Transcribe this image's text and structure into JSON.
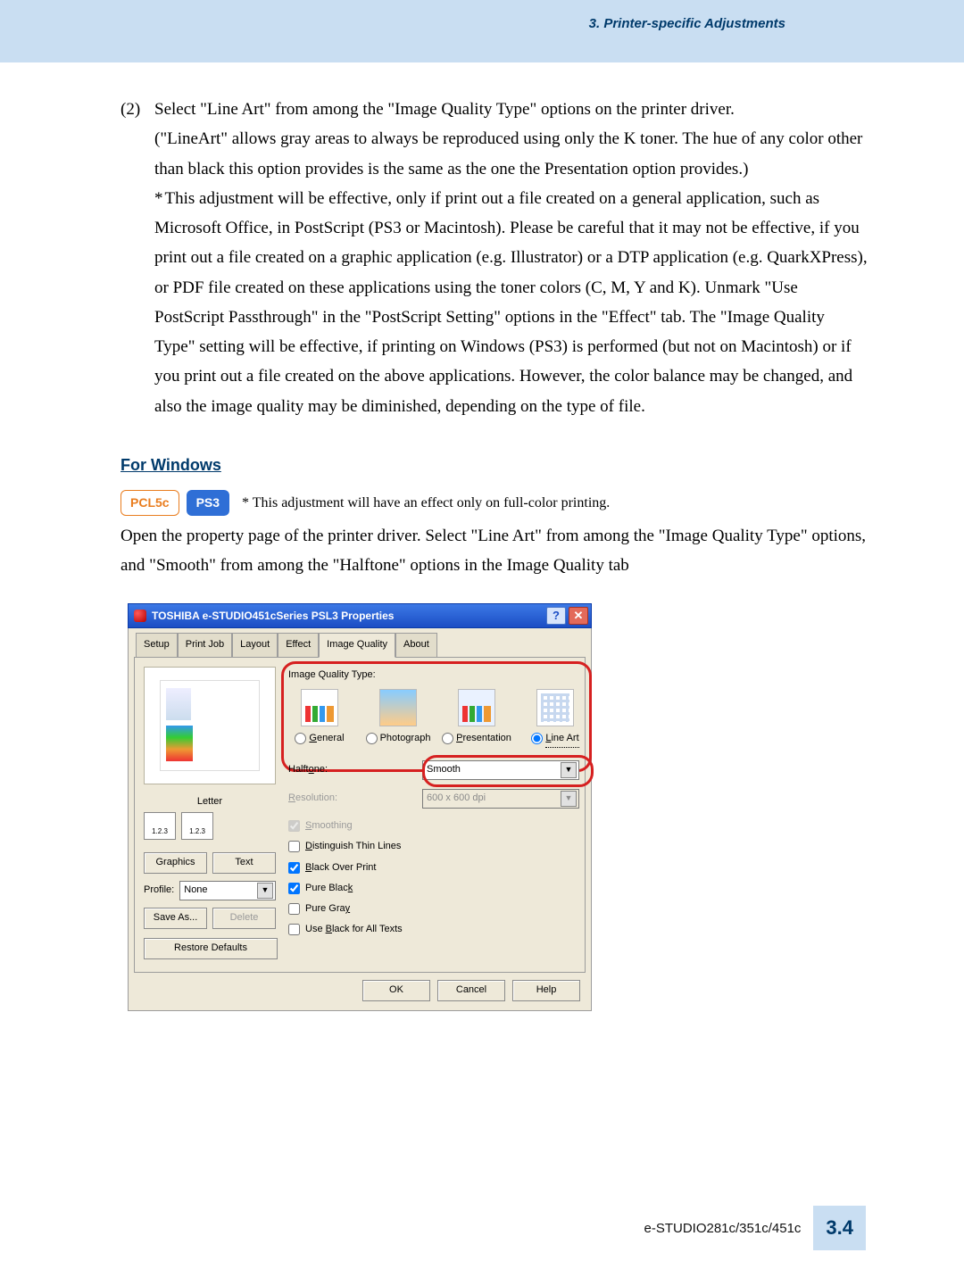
{
  "header": {
    "section": "3. Printer-specific Adjustments"
  },
  "body": {
    "step_num": "(2)",
    "step_line1": "Select \"Line Art\" from among the \"Image Quality Type\" options on the printer driver.",
    "step_line2": "(\"LineArt\" allows gray areas to always be reproduced using only the K toner.  The hue of any color other than black this option provides is the same as the one the Presentation option provides.)",
    "note_star": "*",
    "note_body": "This adjustment will be effective, only if print out a file created on a general application, such as Microsoft Office, in PostScript (PS3 or Macintosh).  Please be careful that it may not be effective, if you print out a file created on a graphic application (e.g. Illustrator) or a DTP application (e.g. QuarkXPress), or PDF file created on these applications using the toner colors (C, M, Y and K).  Unmark \"Use PostScript Passthrough\" in the \"PostScript Setting\" options in the \"Effect\" tab.  The \"Image Quality Type\" setting will be effective, if printing on Windows (PS3) is performed (but not on Macintosh) or if you print out a file created on the above applications.  However, the color balance may be changed, and also the image quality may be diminished, depending on the type of file.",
    "for_windows": "For Windows",
    "chip_pcl": "PCL5c",
    "chip_ps": "PS3",
    "chip_note": "* This adjustment will have an effect only on full-color printing.",
    "para2": "Open the property page of the printer driver.  Select \"Line Art\" from among the \"Image Quality Type\" options, and \"Smooth\" from among the \"Halftone\" options in the Image Quality tab"
  },
  "dialog": {
    "title": "TOSHIBA e-STUDIO451cSeries PSL3 Properties",
    "help_btn": "?",
    "close_btn": "✕",
    "tabs": [
      "Setup",
      "Print Job",
      "Layout",
      "Effect",
      "Image Quality",
      "About"
    ],
    "active_tab": 4,
    "left": {
      "paper": "Letter",
      "icon_cap": "1.2.3",
      "btn_graphics": "Graphics",
      "btn_text": "Text",
      "profile_label": "Profile:",
      "profile_value": "None",
      "btn_save": "Save As...",
      "btn_delete": "Delete",
      "btn_restore": "Restore Defaults"
    },
    "right": {
      "iq_label": "Image Quality Type:",
      "opts": {
        "general": "General",
        "photo": "Photograph",
        "presentation": "Presentation",
        "lineart": "Line Art"
      },
      "halftone_label": "Halftone:",
      "halftone_value": "Smooth",
      "resolution_label": "Resolution:",
      "resolution_value": "600 x 600 dpi",
      "cb_smoothing": "Smoothing",
      "cb_thin": "Distinguish Thin Lines",
      "cb_bop": "Black Over Print",
      "cb_pblack": "Pure Black",
      "cb_pgray": "Pure Gray",
      "cb_useblack": "Use Black for All Texts"
    },
    "footer": {
      "ok": "OK",
      "cancel": "Cancel",
      "help": "Help"
    }
  },
  "footer": {
    "model": "e-STUDIO281c/351c/451c",
    "page": "3.4"
  }
}
